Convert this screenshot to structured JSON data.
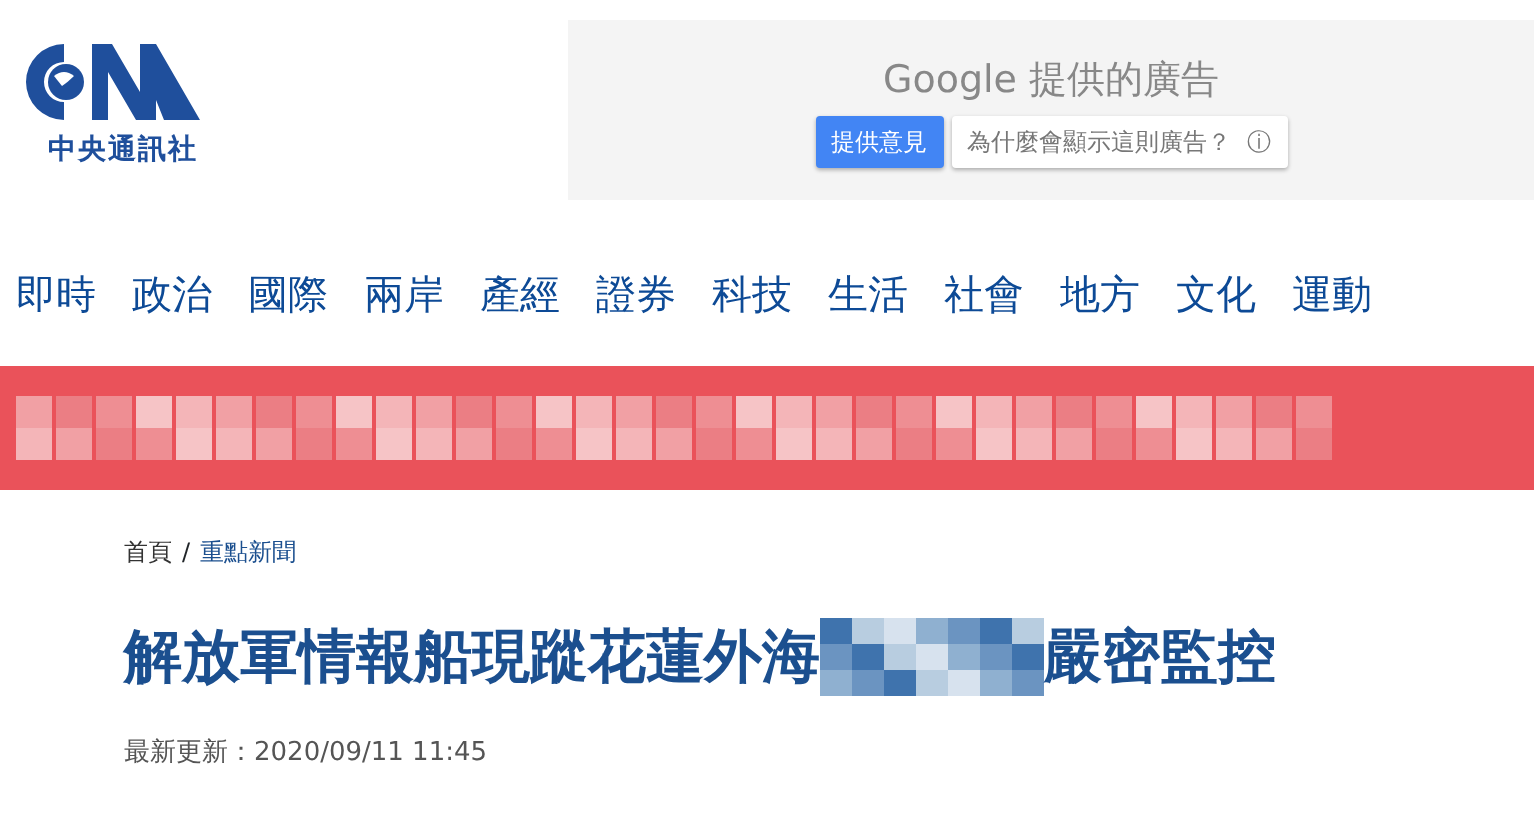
{
  "logo": {
    "tagline": "中央通訊社"
  },
  "ad": {
    "title": "Google 提供的廣告",
    "feedback_button": "提供意見",
    "why_button": "為什麼會顯示這則廣告？",
    "info_icon": "ⓘ"
  },
  "nav": [
    {
      "label": "即時"
    },
    {
      "label": "政治"
    },
    {
      "label": "國際"
    },
    {
      "label": "兩岸"
    },
    {
      "label": "產經"
    },
    {
      "label": "證券"
    },
    {
      "label": "科技"
    },
    {
      "label": "生活"
    },
    {
      "label": "社會"
    },
    {
      "label": "地方"
    },
    {
      "label": "文化"
    },
    {
      "label": "運動"
    }
  ],
  "breadcrumb": [
    {
      "label": "首頁",
      "kind": "home"
    },
    {
      "label": "重點新聞",
      "kind": "section"
    }
  ],
  "breadcrumb_separator": "/",
  "headline": {
    "before": "解放軍情報船現蹤花蓮外海",
    "redacted": true,
    "after": "嚴密監控"
  },
  "updated": "最新更新：2020/09/11 11:45"
}
